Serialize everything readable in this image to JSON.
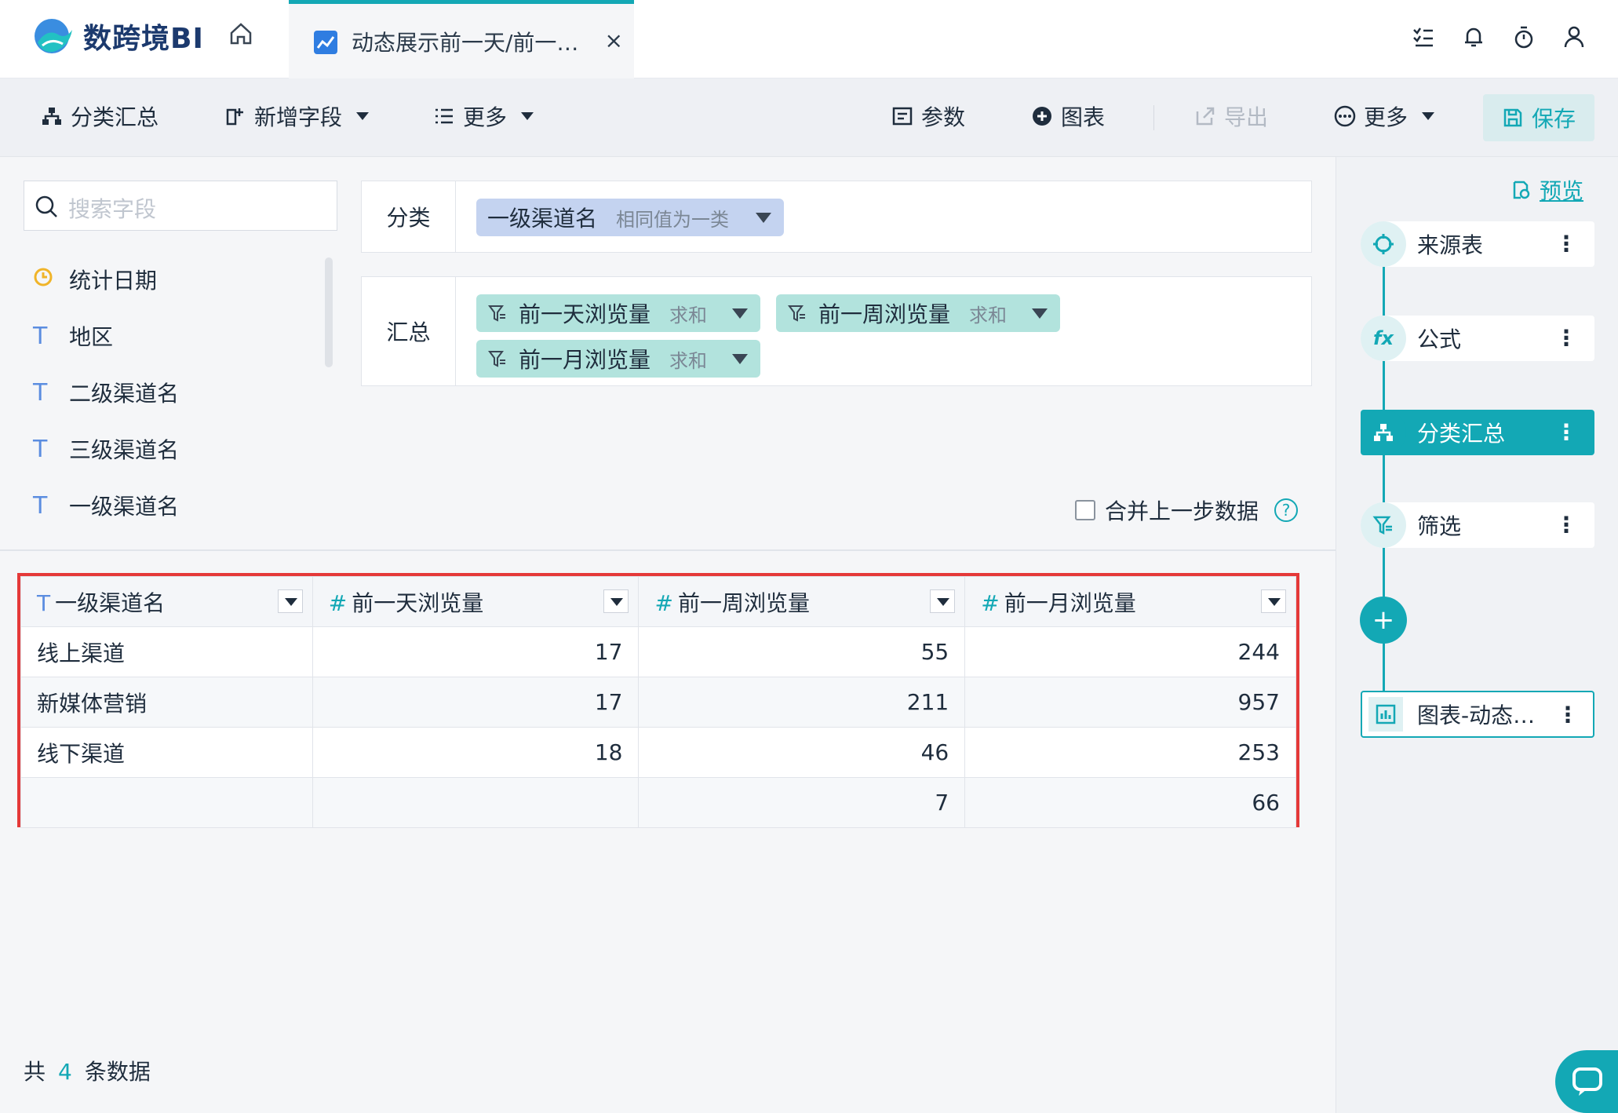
{
  "app": {
    "logo_text": "数跨境BI",
    "tab_title": "动态展示前一天/前一…",
    "tab_close": "×"
  },
  "toolbar": {
    "group_summary": "分类汇总",
    "add_field": "新增字段",
    "more_left": "更多",
    "params": "参数",
    "chart": "图表",
    "export": "导出",
    "more_right": "更多",
    "save": "保存"
  },
  "fields": {
    "search_placeholder": "搜索字段",
    "items": [
      {
        "type": "date",
        "label": "统计日期"
      },
      {
        "type": "T",
        "label": "地区"
      },
      {
        "type": "T",
        "label": "二级渠道名"
      },
      {
        "type": "T",
        "label": "三级渠道名"
      },
      {
        "type": "T",
        "label": "一级渠道名"
      }
    ]
  },
  "config": {
    "category_label": "分类",
    "category_chip": {
      "name": "一级渠道名",
      "mode": "相同值为一类"
    },
    "summary_label": "汇总",
    "summary_chips": [
      {
        "name": "前一天浏览量",
        "agg": "求和"
      },
      {
        "name": "前一周浏览量",
        "agg": "求和"
      },
      {
        "name": "前一月浏览量",
        "agg": "求和"
      }
    ],
    "merge_label": "合并上一步数据",
    "help": "?"
  },
  "table": {
    "columns": [
      {
        "type": "T",
        "name": "一级渠道名"
      },
      {
        "type": "#",
        "name": "前一天浏览量"
      },
      {
        "type": "#",
        "name": "前一周浏览量"
      },
      {
        "type": "#",
        "name": "前一月浏览量"
      }
    ],
    "rows": [
      [
        "线上渠道",
        "17",
        "55",
        "244"
      ],
      [
        "新媒体营销",
        "17",
        "211",
        "957"
      ],
      [
        "线下渠道",
        "18",
        "46",
        "253"
      ],
      [
        "",
        "",
        "7",
        "66"
      ]
    ]
  },
  "footer": {
    "prefix": "共",
    "count": "4",
    "suffix": "条数据"
  },
  "flow": {
    "preview": "预览",
    "nodes": [
      {
        "label": "来源表",
        "icon": "crosshair-icon"
      },
      {
        "label": "公式",
        "icon": "fx-icon",
        "icon_text": "fx"
      },
      {
        "label": "分类汇总",
        "icon": "hierarchy-icon",
        "active": true
      },
      {
        "label": "筛选",
        "icon": "filter-icon"
      }
    ],
    "add": "+",
    "chart_node": "图表-动态…",
    "dots": "⋮"
  },
  "colors": {
    "accent": "#13a8b5",
    "highlight_border": "#e53939"
  }
}
